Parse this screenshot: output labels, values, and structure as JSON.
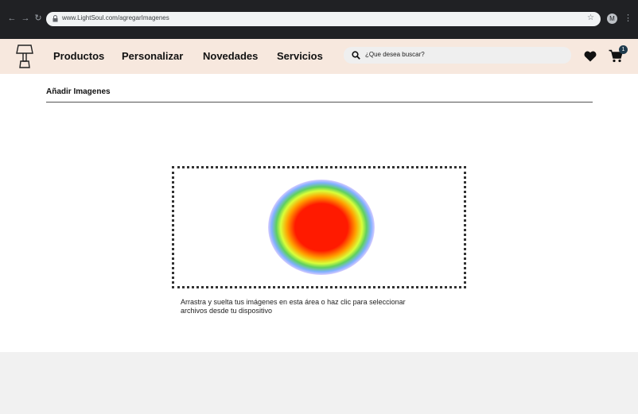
{
  "browser": {
    "url": "www.LightSoul.com/agregarImagenes",
    "profile_initial": "M",
    "icons": [
      "back-arrow-icon",
      "forward-arrow-icon",
      "reload-icon",
      "lock-icon",
      "star-icon",
      "kebab-menu-icon"
    ]
  },
  "header": {
    "nav": [
      "Productos",
      "Personalizar",
      "Novedades",
      "Servicios"
    ],
    "search_placeholder": "¿Que desea buscar?",
    "cart_count": "1",
    "colors": {
      "header_bg": "#f7e8de",
      "badge": "#1f3b4d"
    }
  },
  "main": {
    "title": "Añadir Imagenes",
    "dropzone_text_1": "Arrastra y suelta tus imágenes en esta área o haz clic para seleccionar",
    "dropzone_text_2": "archivos desde tu dispositivo"
  }
}
